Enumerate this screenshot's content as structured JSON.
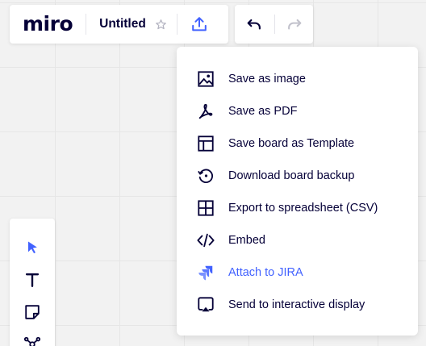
{
  "topbar": {
    "logo": "miro",
    "board_title": "Untitled",
    "star_icon": "star-icon",
    "export_icon": "upload-icon"
  },
  "history": {
    "undo_icon": "undo-icon",
    "redo_icon": "redo-icon"
  },
  "export_menu": {
    "items": [
      {
        "label": "Save as image",
        "icon": "image-icon"
      },
      {
        "label": "Save as PDF",
        "icon": "pdf-icon"
      },
      {
        "label": "Save board as Template",
        "icon": "template-icon"
      },
      {
        "label": "Download board backup",
        "icon": "backup-icon"
      },
      {
        "label": "Export to spreadsheet (CSV)",
        "icon": "table-icon"
      },
      {
        "label": "Embed",
        "icon": "code-icon"
      },
      {
        "label": "Attach to JIRA",
        "icon": "jira-icon"
      },
      {
        "label": "Send to interactive display",
        "icon": "display-icon"
      }
    ]
  },
  "toolbar": {
    "tools": [
      {
        "name": "select",
        "icon": "cursor-icon"
      },
      {
        "name": "text",
        "icon": "text-icon"
      },
      {
        "name": "sticky-note",
        "icon": "sticky-note-icon"
      },
      {
        "name": "mind-map",
        "icon": "mind-map-icon"
      }
    ]
  },
  "colors": {
    "primary_text": "#050038",
    "accent": "#4262ff",
    "canvas_bg": "#f2f2f2",
    "grid_line": "#e6e6e6",
    "disabled": "#c2c2cc"
  }
}
